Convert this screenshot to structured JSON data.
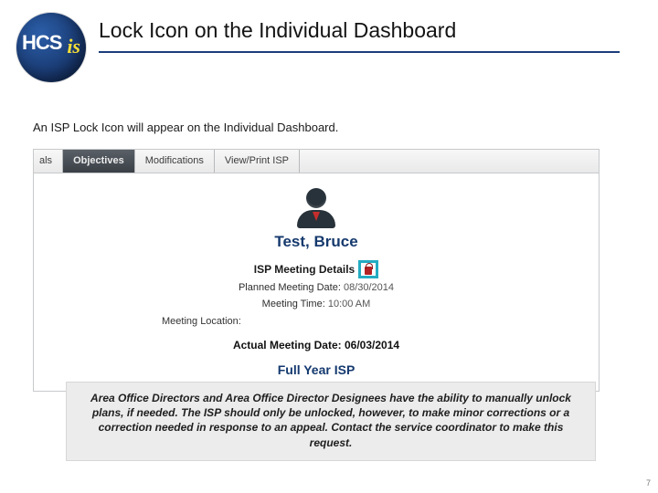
{
  "header": {
    "logo_main": "HCS",
    "logo_sub": "is",
    "title": "Lock Icon on the Individual Dashboard"
  },
  "intro": "An ISP Lock Icon will appear on the Individual Dashboard.",
  "screenshot": {
    "tabs": {
      "partial": "als",
      "objectives": "Objectives",
      "modifications": "Modifications",
      "view_print": "View/Print ISP"
    },
    "individual_name": "Test, Bruce",
    "details_label": "ISP Meeting Details",
    "planned_label": "Planned Meeting Date:",
    "planned_value": "08/30/2014",
    "time_label": "Meeting Time:",
    "time_value": "10:00 AM",
    "location_label": "Meeting Location:",
    "actual_label": "Actual Meeting Date:",
    "actual_value": "06/03/2014",
    "plan_type": "Full Year ISP"
  },
  "note": "Area Office Directors and Area Office Director Designees have the ability to manually unlock plans, if needed. The ISP should only be unlocked, however, to make minor corrections or a correction needed in response to an appeal.  Contact the service coordinator to make this request.",
  "page_number": "7"
}
